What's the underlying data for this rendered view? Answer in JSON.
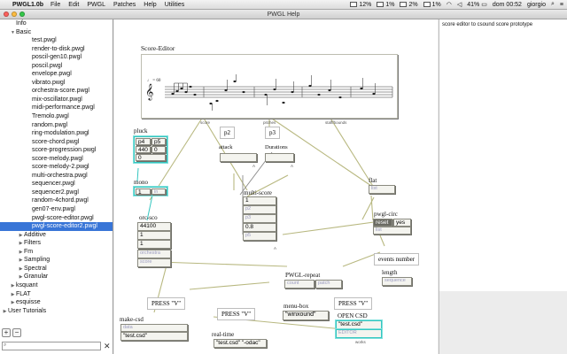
{
  "menubar": {
    "app_name": "PWGL1.0b",
    "items": [
      "File",
      "Edit",
      "PWGL",
      "Patches",
      "Help",
      "Utilities"
    ],
    "status": {
      "cpu_a": "12%",
      "cpu_b": "1%",
      "cpu_c": "2%",
      "cpu_d": "1%",
      "battery": "41%",
      "clock": "dom 00:52",
      "user": "giorgio"
    }
  },
  "window": {
    "title": "PWGL Help"
  },
  "sidebar": {
    "items": [
      {
        "label": "Info",
        "indent": 1,
        "triangle": "",
        "selected": false
      },
      {
        "label": "Basic",
        "indent": 1,
        "triangle": "▼",
        "selected": false
      },
      {
        "label": "test.pwgl",
        "indent": 3,
        "triangle": "",
        "selected": false
      },
      {
        "label": "render-to-disk.pwgl",
        "indent": 3,
        "triangle": "",
        "selected": false
      },
      {
        "label": "poscil-gen10.pwgl",
        "indent": 3,
        "triangle": "",
        "selected": false
      },
      {
        "label": "poscil.pwgl",
        "indent": 3,
        "triangle": "",
        "selected": false
      },
      {
        "label": "envelope.pwgl",
        "indent": 3,
        "triangle": "",
        "selected": false
      },
      {
        "label": "vibrato.pwgl",
        "indent": 3,
        "triangle": "",
        "selected": false
      },
      {
        "label": "orchestra-score.pwgl",
        "indent": 3,
        "triangle": "",
        "selected": false
      },
      {
        "label": "mix-oscillator.pwgl",
        "indent": 3,
        "triangle": "",
        "selected": false
      },
      {
        "label": "midi-performance.pwgl",
        "indent": 3,
        "triangle": "",
        "selected": false
      },
      {
        "label": "Tremolo.pwgl",
        "indent": 3,
        "triangle": "",
        "selected": false
      },
      {
        "label": "random.pwgl",
        "indent": 3,
        "triangle": "",
        "selected": false
      },
      {
        "label": "ring-modulation.pwgl",
        "indent": 3,
        "triangle": "",
        "selected": false
      },
      {
        "label": "score-chord.pwgl",
        "indent": 3,
        "triangle": "",
        "selected": false
      },
      {
        "label": "score-progression.pwgl",
        "indent": 3,
        "triangle": "",
        "selected": false
      },
      {
        "label": "score-melody.pwgl",
        "indent": 3,
        "triangle": "",
        "selected": false
      },
      {
        "label": "score-melody-2.pwgl",
        "indent": 3,
        "triangle": "",
        "selected": false
      },
      {
        "label": "multi-orchestra.pwgl",
        "indent": 3,
        "triangle": "",
        "selected": false
      },
      {
        "label": "sequencer.pwgl",
        "indent": 3,
        "triangle": "",
        "selected": false
      },
      {
        "label": "sequencer2.pwgl",
        "indent": 3,
        "triangle": "",
        "selected": false
      },
      {
        "label": "random-4chord.pwgl",
        "indent": 3,
        "triangle": "",
        "selected": false
      },
      {
        "label": "gen07-env.pwgl",
        "indent": 3,
        "triangle": "",
        "selected": false
      },
      {
        "label": "pwgl-score-editor.pwgl",
        "indent": 3,
        "triangle": "",
        "selected": false
      },
      {
        "label": "pwgl-score-editor2.pwgl",
        "indent": 3,
        "triangle": "",
        "selected": true
      },
      {
        "label": "Additive",
        "indent": 2,
        "triangle": "▶",
        "selected": false
      },
      {
        "label": "Filters",
        "indent": 2,
        "triangle": "▶",
        "selected": false
      },
      {
        "label": "Fm",
        "indent": 2,
        "triangle": "▶",
        "selected": false
      },
      {
        "label": "Sampling",
        "indent": 2,
        "triangle": "▶",
        "selected": false
      },
      {
        "label": "Spectral",
        "indent": 2,
        "triangle": "▶",
        "selected": false
      },
      {
        "label": "Granular",
        "indent": 2,
        "triangle": "▶",
        "selected": false
      },
      {
        "label": "ksquant",
        "indent": 1,
        "triangle": "▶",
        "selected": false
      },
      {
        "label": "FLAT",
        "indent": 1,
        "triangle": "▶",
        "selected": false
      },
      {
        "label": "esquisse",
        "indent": 1,
        "triangle": "▶",
        "selected": false
      },
      {
        "label": "User Tutorials",
        "indent": 0,
        "triangle": "▶",
        "selected": false
      }
    ],
    "add_label": "+",
    "remove_label": "−",
    "search_value": "",
    "clear_label": "✕"
  },
  "info": {
    "text": "score editor to csound score prototype"
  },
  "patch": {
    "score_editor": {
      "title": "Score-Editor",
      "ports": [
        "score",
        "pitches",
        "staff/bounds"
      ],
      "tempo": "♩ = 60"
    },
    "p2": {
      "title": "p2",
      "label": "attack"
    },
    "p3": {
      "title": "p3",
      "label": "Durations"
    },
    "pluck": {
      "label": "pluck",
      "h1": "p4",
      "h2": "p5",
      "v1": "440",
      "v2": "0",
      "v3": "0"
    },
    "mono": {
      "label": "mono",
      "v1": "1",
      "port": "in"
    },
    "multi_score": {
      "label": "multi-score",
      "rows": [
        "1",
        "p2",
        "p3",
        "0.8",
        "p5"
      ]
    },
    "orc_sco": {
      "label": "orc-sco",
      "rows": [
        "44100",
        "1",
        "1"
      ],
      "ports": [
        "orchestra",
        "score"
      ]
    },
    "flat": {
      "label": "flat",
      "port": "list"
    },
    "pwgl_circ": {
      "label": "pwgl-circ",
      "reset": "reset",
      "yes": "yes",
      "port": "list"
    },
    "events_number": {
      "label": "events number"
    },
    "length": {
      "label": "length",
      "port": "sequence"
    },
    "pwgl_repeat": {
      "label": "PWGL-repeat",
      "p1": "count",
      "p2": "patch"
    },
    "press_1": {
      "text": "PRESS \"V\""
    },
    "press_2": {
      "text": "PRESS \"V\""
    },
    "press_3": {
      "text": "PRESS \"V\""
    },
    "make_csd": {
      "label": "make-csd",
      "port": "data",
      "value": "\"test.csd\""
    },
    "real_time": {
      "label": "real-time",
      "value": "\"test.csd\" \"-odac\""
    },
    "menu_box": {
      "label": "menu-box",
      "value": "\"winxound\""
    },
    "open_csd": {
      "label": "OPEN CSD",
      "value": "\"test.csd\"",
      "editor": "EDITOR",
      "port": "works"
    }
  }
}
